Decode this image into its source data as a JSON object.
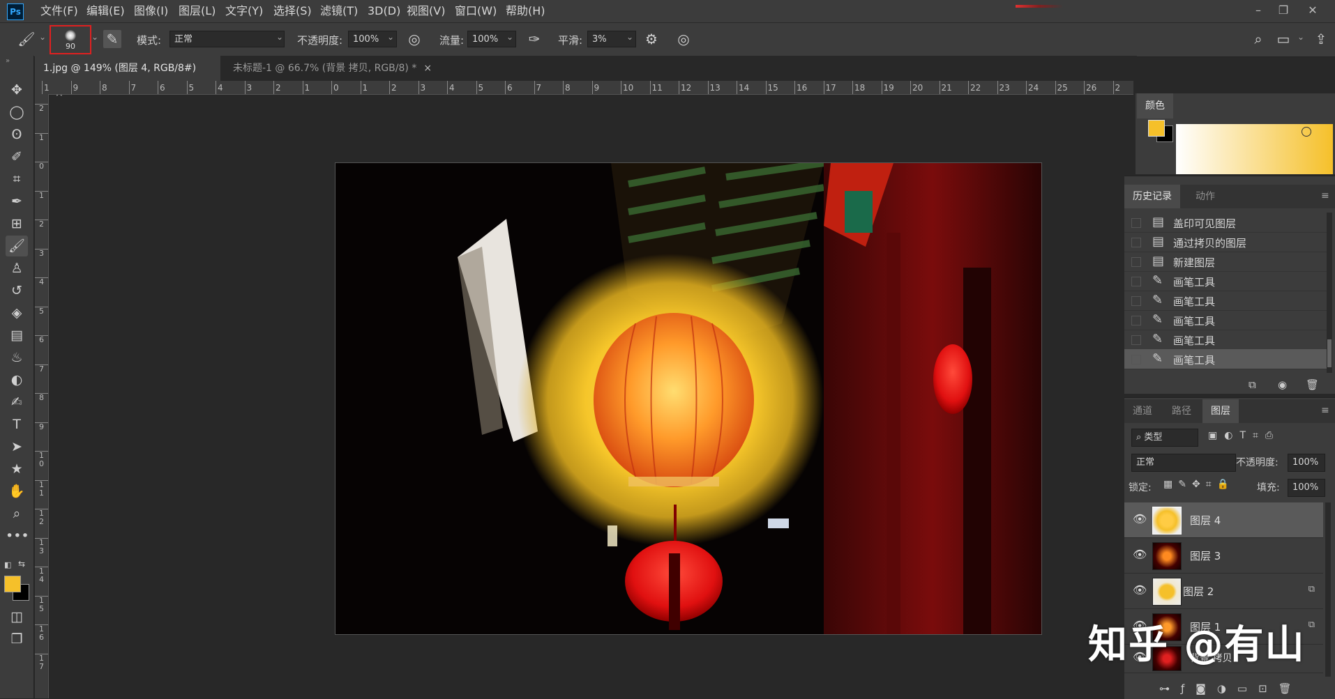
{
  "app": {
    "logo": "Ps"
  },
  "menu": [
    "文件(F)",
    "编辑(E)",
    "图像(I)",
    "图层(L)",
    "文字(Y)",
    "选择(S)",
    "滤镜(T)",
    "3D(D)",
    "视图(V)",
    "窗口(W)",
    "帮助(H)"
  ],
  "options": {
    "brush_size": "90",
    "mode_label": "模式:",
    "mode_value": "正常",
    "opacity_label": "不透明度:",
    "opacity_value": "100%",
    "flow_label": "流量:",
    "flow_value": "100%",
    "smoothing_label": "平滑:",
    "smoothing_value": "3%"
  },
  "tabs": [
    {
      "label": "1.jpg @ 149% (图层 4, RGB/8#) *",
      "close": "×"
    },
    {
      "label": "未标题-1 @ 66.7% (背景 拷贝, RGB/8) *",
      "close": "×"
    }
  ],
  "ruler_h": [
    "1",
    "9",
    "8",
    "7",
    "6",
    "5",
    "4",
    "3",
    "2",
    "1",
    "0",
    "1",
    "2",
    "3",
    "4",
    "5",
    "6",
    "7",
    "8",
    "9",
    "10",
    "11",
    "12",
    "13",
    "14",
    "15",
    "16",
    "17",
    "18",
    "19",
    "20",
    "21",
    "22",
    "23",
    "24",
    "25",
    "26",
    "2"
  ],
  "ruler_v": [
    "2",
    "1",
    "0",
    "1",
    "2",
    "3",
    "4",
    "5",
    "6",
    "7",
    "8",
    "9",
    "1\n0",
    "1\n1",
    "1\n2",
    "1\n3",
    "1\n4",
    "1\n5",
    "1\n6",
    "1\n7"
  ],
  "color_panel": {
    "title": "颜色",
    "foreground": "#f5c02a",
    "background": "#000000"
  },
  "history": {
    "tabs": [
      "历史记录",
      "动作"
    ],
    "items": [
      "盖印可见图层",
      "通过拷贝的图层",
      "新建图层",
      "画笔工具",
      "画笔工具",
      "画笔工具",
      "画笔工具",
      "画笔工具"
    ]
  },
  "layers": {
    "tabs": [
      "通道",
      "路径",
      "图层"
    ],
    "filter_label": "类型",
    "blend_mode": "正常",
    "opacity_label": "不透明度:",
    "opacity_value": "100%",
    "lock_label": "锁定:",
    "fill_label": "填充:",
    "fill_value": "100%",
    "items": [
      "图层 4",
      "图层 3",
      "图层 2",
      "图层 1",
      "背景 拷贝"
    ]
  },
  "watermark": "知乎 @有山"
}
